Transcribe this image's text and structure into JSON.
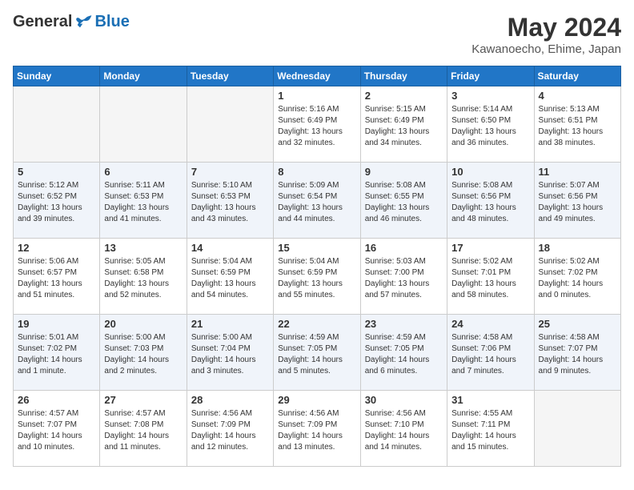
{
  "logo": {
    "general": "General",
    "blue": "Blue"
  },
  "title": "May 2024",
  "location": "Kawanoecho, Ehime, Japan",
  "days_header": [
    "Sunday",
    "Monday",
    "Tuesday",
    "Wednesday",
    "Thursday",
    "Friday",
    "Saturday"
  ],
  "weeks": [
    [
      {
        "day": "",
        "empty": true
      },
      {
        "day": "",
        "empty": true
      },
      {
        "day": "",
        "empty": true
      },
      {
        "day": "1",
        "sunrise": "5:16 AM",
        "sunset": "6:49 PM",
        "daylight": "13 hours and 32 minutes."
      },
      {
        "day": "2",
        "sunrise": "5:15 AM",
        "sunset": "6:49 PM",
        "daylight": "13 hours and 34 minutes."
      },
      {
        "day": "3",
        "sunrise": "5:14 AM",
        "sunset": "6:50 PM",
        "daylight": "13 hours and 36 minutes."
      },
      {
        "day": "4",
        "sunrise": "5:13 AM",
        "sunset": "6:51 PM",
        "daylight": "13 hours and 38 minutes."
      }
    ],
    [
      {
        "day": "5",
        "sunrise": "5:12 AM",
        "sunset": "6:52 PM",
        "daylight": "13 hours and 39 minutes."
      },
      {
        "day": "6",
        "sunrise": "5:11 AM",
        "sunset": "6:53 PM",
        "daylight": "13 hours and 41 minutes."
      },
      {
        "day": "7",
        "sunrise": "5:10 AM",
        "sunset": "6:53 PM",
        "daylight": "13 hours and 43 minutes."
      },
      {
        "day": "8",
        "sunrise": "5:09 AM",
        "sunset": "6:54 PM",
        "daylight": "13 hours and 44 minutes."
      },
      {
        "day": "9",
        "sunrise": "5:08 AM",
        "sunset": "6:55 PM",
        "daylight": "13 hours and 46 minutes."
      },
      {
        "day": "10",
        "sunrise": "5:08 AM",
        "sunset": "6:56 PM",
        "daylight": "13 hours and 48 minutes."
      },
      {
        "day": "11",
        "sunrise": "5:07 AM",
        "sunset": "6:56 PM",
        "daylight": "13 hours and 49 minutes."
      }
    ],
    [
      {
        "day": "12",
        "sunrise": "5:06 AM",
        "sunset": "6:57 PM",
        "daylight": "13 hours and 51 minutes."
      },
      {
        "day": "13",
        "sunrise": "5:05 AM",
        "sunset": "6:58 PM",
        "daylight": "13 hours and 52 minutes."
      },
      {
        "day": "14",
        "sunrise": "5:04 AM",
        "sunset": "6:59 PM",
        "daylight": "13 hours and 54 minutes."
      },
      {
        "day": "15",
        "sunrise": "5:04 AM",
        "sunset": "6:59 PM",
        "daylight": "13 hours and 55 minutes."
      },
      {
        "day": "16",
        "sunrise": "5:03 AM",
        "sunset": "7:00 PM",
        "daylight": "13 hours and 57 minutes."
      },
      {
        "day": "17",
        "sunrise": "5:02 AM",
        "sunset": "7:01 PM",
        "daylight": "13 hours and 58 minutes."
      },
      {
        "day": "18",
        "sunrise": "5:02 AM",
        "sunset": "7:02 PM",
        "daylight": "14 hours and 0 minutes."
      }
    ],
    [
      {
        "day": "19",
        "sunrise": "5:01 AM",
        "sunset": "7:02 PM",
        "daylight": "14 hours and 1 minute."
      },
      {
        "day": "20",
        "sunrise": "5:00 AM",
        "sunset": "7:03 PM",
        "daylight": "14 hours and 2 minutes."
      },
      {
        "day": "21",
        "sunrise": "5:00 AM",
        "sunset": "7:04 PM",
        "daylight": "14 hours and 3 minutes."
      },
      {
        "day": "22",
        "sunrise": "4:59 AM",
        "sunset": "7:05 PM",
        "daylight": "14 hours and 5 minutes."
      },
      {
        "day": "23",
        "sunrise": "4:59 AM",
        "sunset": "7:05 PM",
        "daylight": "14 hours and 6 minutes."
      },
      {
        "day": "24",
        "sunrise": "4:58 AM",
        "sunset": "7:06 PM",
        "daylight": "14 hours and 7 minutes."
      },
      {
        "day": "25",
        "sunrise": "4:58 AM",
        "sunset": "7:07 PM",
        "daylight": "14 hours and 9 minutes."
      }
    ],
    [
      {
        "day": "26",
        "sunrise": "4:57 AM",
        "sunset": "7:07 PM",
        "daylight": "14 hours and 10 minutes."
      },
      {
        "day": "27",
        "sunrise": "4:57 AM",
        "sunset": "7:08 PM",
        "daylight": "14 hours and 11 minutes."
      },
      {
        "day": "28",
        "sunrise": "4:56 AM",
        "sunset": "7:09 PM",
        "daylight": "14 hours and 12 minutes."
      },
      {
        "day": "29",
        "sunrise": "4:56 AM",
        "sunset": "7:09 PM",
        "daylight": "14 hours and 13 minutes."
      },
      {
        "day": "30",
        "sunrise": "4:56 AM",
        "sunset": "7:10 PM",
        "daylight": "14 hours and 14 minutes."
      },
      {
        "day": "31",
        "sunrise": "4:55 AM",
        "sunset": "7:11 PM",
        "daylight": "14 hours and 15 minutes."
      },
      {
        "day": "",
        "empty": true
      }
    ]
  ]
}
